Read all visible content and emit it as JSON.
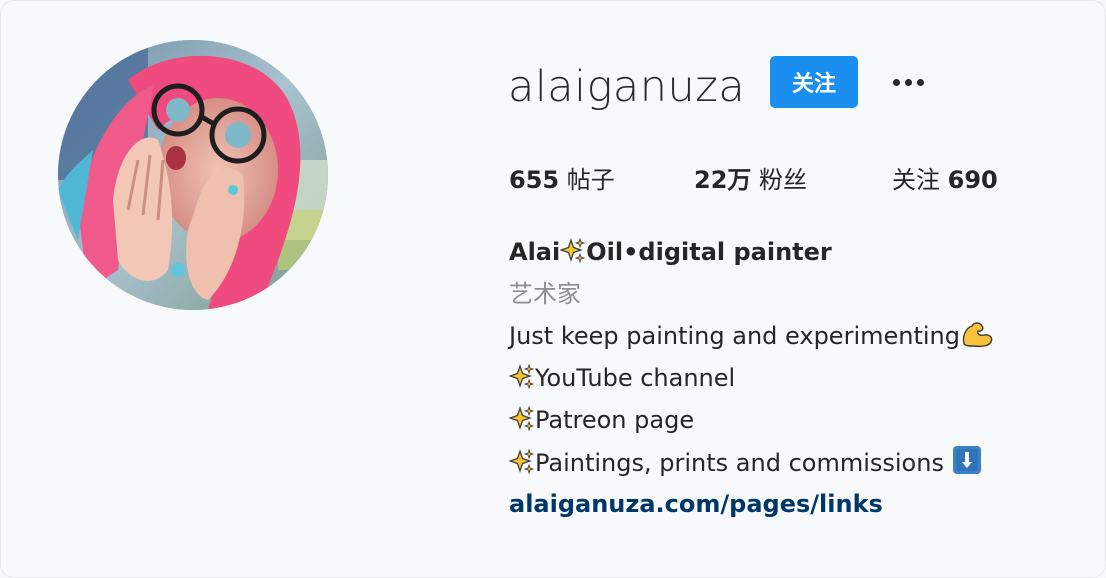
{
  "profile": {
    "username": "alaiganuza",
    "follow_label": "关注",
    "more_label": "更多选项"
  },
  "stats": {
    "posts_count": "655",
    "posts_label": "帖子",
    "followers_count": "22万",
    "followers_label": "粉丝",
    "following_label": "关注",
    "following_count": "690"
  },
  "bio": {
    "name_prefix": "Alai",
    "name_suffix": "Oil•digital painter",
    "category": "艺术家",
    "tagline": "Just keep painting and experimenting",
    "youtube": "YouTube channel",
    "patreon": "Patreon page",
    "paintings": "Paintings, prints and commissions ",
    "link": "alaiganuza.com/pages/links"
  },
  "colors": {
    "accent": "#1a8ff0",
    "link": "#00376b",
    "muted_text": "#8e8e8e",
    "text": "#262626",
    "background": "#f8f9fb"
  },
  "icons": {
    "sparkles": "sparkles-icon",
    "flexed_biceps": "flexed-biceps-icon",
    "arrow_down": "arrow-down-icon",
    "more": "more-dots-icon"
  }
}
